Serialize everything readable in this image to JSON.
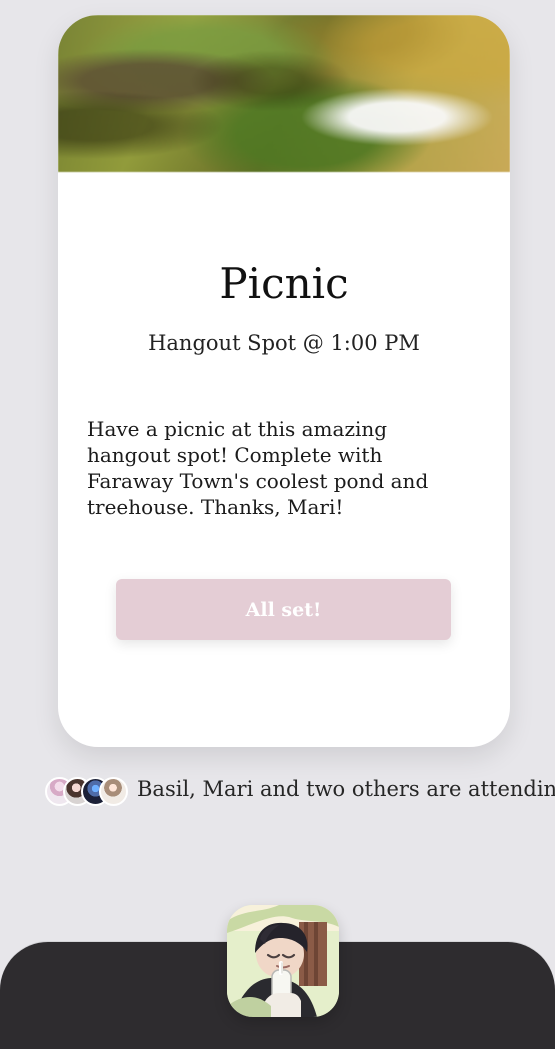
{
  "card": {
    "title": "Picnic",
    "subtitle": "Hangout Spot @ 1:00 PM",
    "description": "Have a picnic at this amazing hangout spot! Complete with Faraway Town's coolest pond and treehouse. Thanks, Mari!",
    "button_label": "All set!"
  },
  "attendees": {
    "text": "Basil, Mari and two others are attending",
    "avatars": [
      "friend-avatar-1",
      "friend-avatar-2",
      "friend-avatar-3",
      "friend-avatar-4"
    ]
  },
  "bottom_bar": {
    "profile_avatar": "profile-avatar"
  },
  "colors": {
    "background": "#e7e6ea",
    "card": "#ffffff",
    "button": "#e4cdd5",
    "bottom_bar": "#2e2c2f"
  }
}
